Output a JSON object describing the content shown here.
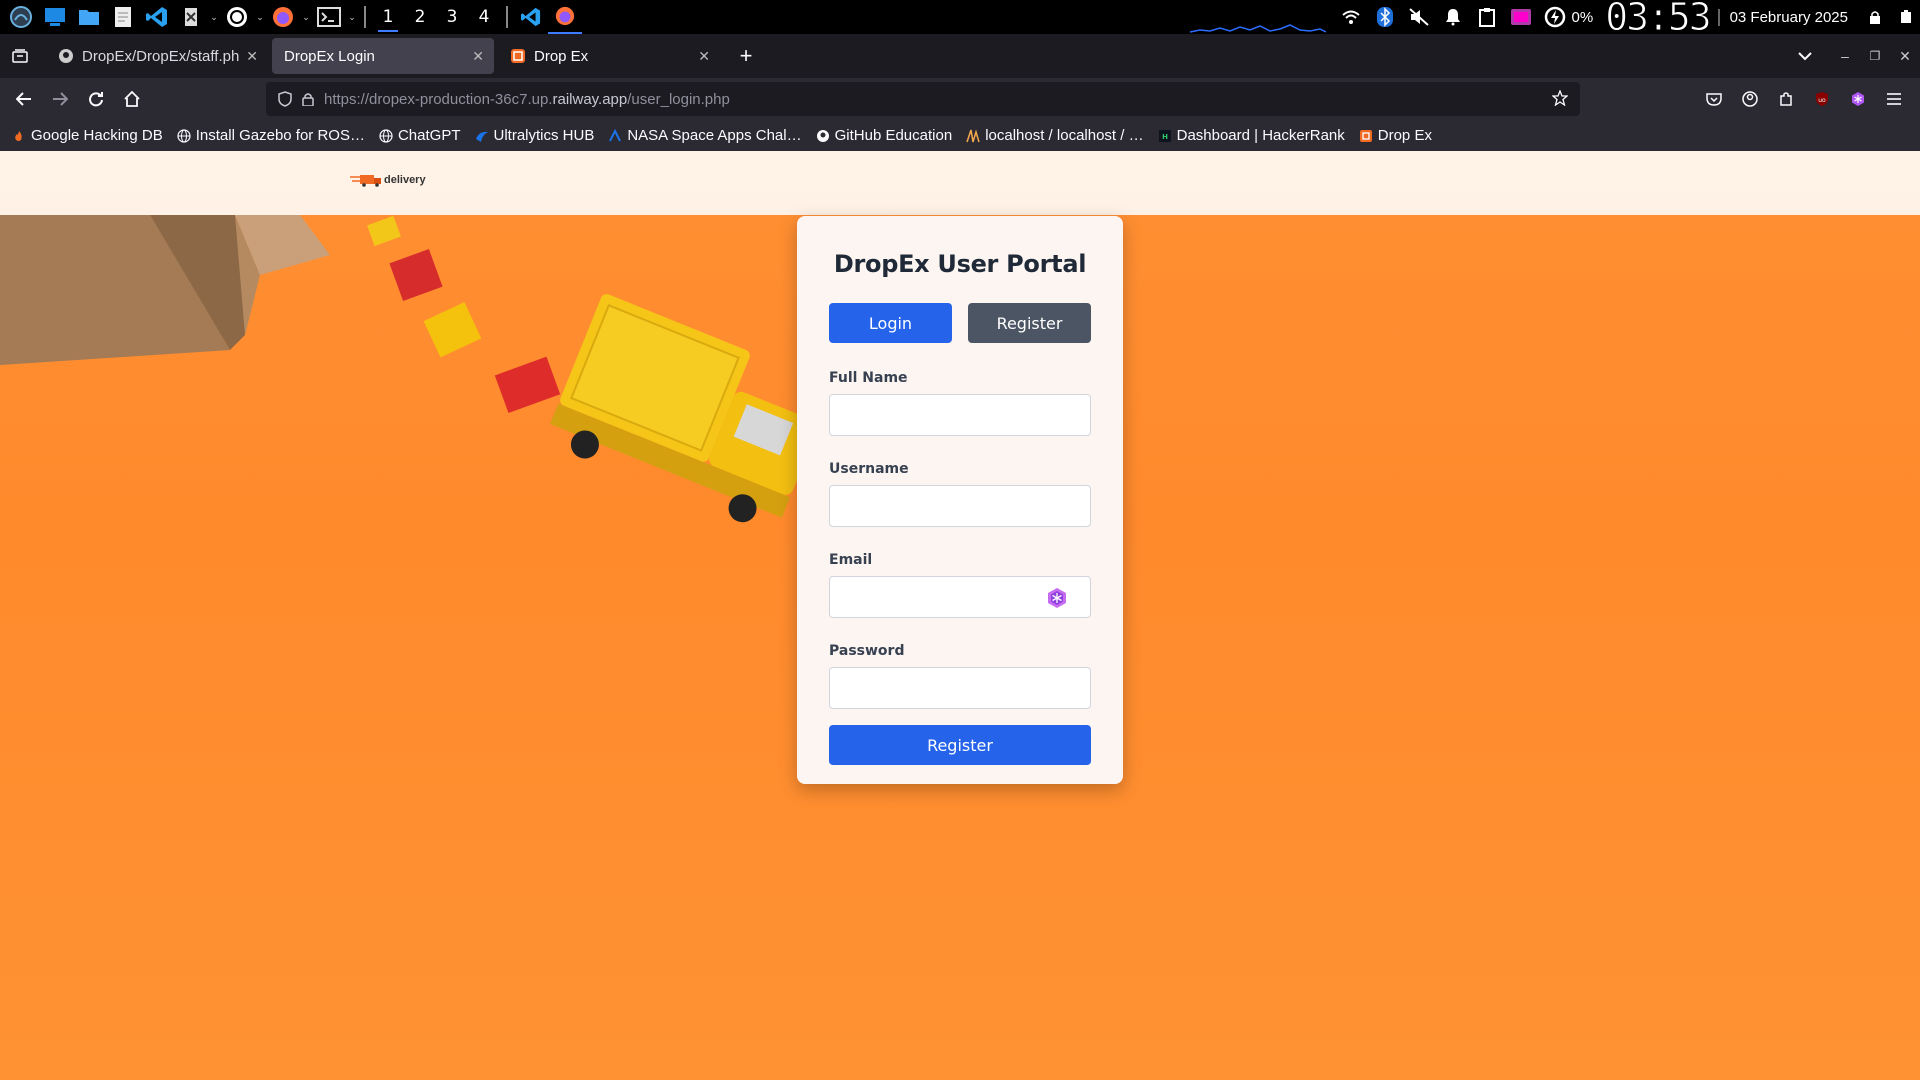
{
  "taskbar": {
    "workspaces": [
      "1",
      "2",
      "3",
      "4"
    ],
    "battery": "0%",
    "clock": "03:53",
    "date": "03 February 2025"
  },
  "tabs": [
    {
      "label": "DropEx/DropEx/staff.ph",
      "close": "✕"
    },
    {
      "label": "DropEx Login",
      "close": "✕"
    },
    {
      "label": "Drop Ex",
      "close": "✕"
    }
  ],
  "new_tab": "+",
  "window_controls": {
    "minimize": "–",
    "restore": "❐",
    "close": "✕"
  },
  "url": {
    "prefix": "https://dropex-production-36c7.up.",
    "domain": "railway.app",
    "path": "/user_login.php"
  },
  "bookmarks": [
    {
      "label": "Google Hacking DB",
      "icon": "flame-icon"
    },
    {
      "label": "Install Gazebo for ROS…",
      "icon": "globe-icon"
    },
    {
      "label": "ChatGPT",
      "icon": "globe-icon"
    },
    {
      "label": "Ultralytics HUB",
      "icon": "ultralytics-icon"
    },
    {
      "label": "NASA Space Apps Chal…",
      "icon": "nasa-icon"
    },
    {
      "label": "GitHub Education",
      "icon": "github-icon"
    },
    {
      "label": "localhost / localhost / …",
      "icon": "phpmyadmin-icon"
    },
    {
      "label": "Dashboard | HackerRank",
      "icon": "hackerrank-icon"
    },
    {
      "label": "Drop Ex",
      "icon": "dropex-icon"
    }
  ],
  "site": {
    "logo_text": "delivery"
  },
  "portal": {
    "title": "DropEx User Portal",
    "login_tab": "Login",
    "register_tab": "Register",
    "fields": {
      "full_name": {
        "label": "Full Name",
        "value": ""
      },
      "username": {
        "label": "Username",
        "value": ""
      },
      "email": {
        "label": "Email",
        "value": ""
      },
      "password": {
        "label": "Password",
        "value": ""
      }
    },
    "submit": "Register"
  },
  "colors": {
    "primary": "#2563eb",
    "secondary": "#4b5563",
    "page_background": "#ff8f33",
    "card_background": "#fcf5f1"
  }
}
